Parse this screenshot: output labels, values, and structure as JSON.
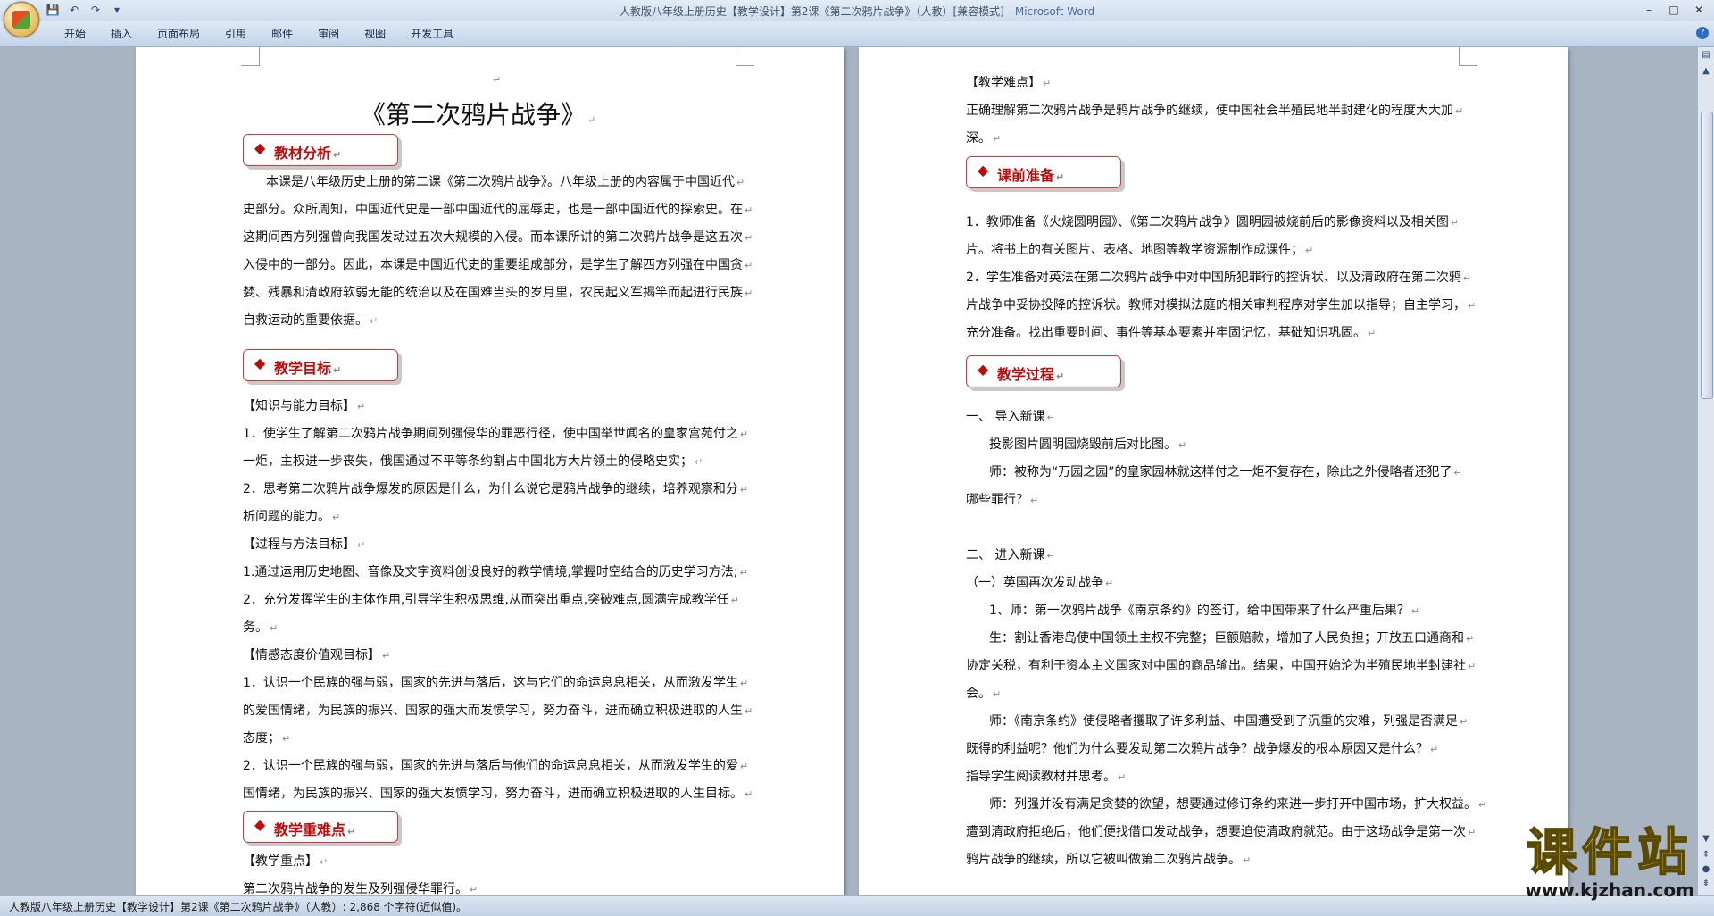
{
  "window": {
    "title": "人教版八年级上册历史【教学设计】第2课《第二次鸦片战争》（人教）[兼容模式] -",
    "app_name": "Microsoft Word",
    "controls": [
      "–",
      "□",
      "✕"
    ]
  },
  "quick_access": [
    "save",
    "undo",
    "redo",
    "customize"
  ],
  "ribbon_tabs": [
    "开始",
    "插入",
    "页面布局",
    "引用",
    "邮件",
    "审阅",
    "视图",
    "开发工具"
  ],
  "left_page": {
    "title": "《第二次鸦片战争》",
    "sections": {
      "analysis": "教材分析",
      "goals": "教学目标",
      "key_points": "教学重难点"
    },
    "lines": [
      "本课是八年级历史上册的第二课《第二次鸦片战争》。八年级上册的内容属于中国近代",
      "史部分。众所周知，中国近代史是一部中国近代的屈辱史，也是一部中国近代的探索史。在",
      "这期间西方列强曾向我国发动过五次大规模的入侵。而本课所讲的第二次鸦片战争是这五次",
      "入侵中的一部分。因此，本课是中国近代史的重要组成部分，是学生了解西方列强在中国贪",
      "婪、残暴和清政府软弱无能的统治以及在国难当头的岁月里，农民起义军揭竿而起进行民族",
      "自救运动的重要依据。",
      "【知识与能力目标】",
      "1．使学生了解第二次鸦片战争期间列强侵华的罪恶行径，使中国举世闻名的皇家宫苑付之",
      "一炬，主权进一步丧失，俄国通过不平等条约割占中国北方大片领土的侵略史实；",
      "2．思考第二次鸦片战争爆发的原因是什么，为什么说它是鸦片战争的继续，培养观察和分",
      "析问题的能力。",
      "【过程与方法目标】",
      "1.通过运用历史地图、音像及文字资料创设良好的教学情境,掌握时空结合的历史学习方法;",
      "2．充分发挥学生的主体作用,引导学生积极思维,从而突出重点,突破难点,圆满完成教学任",
      "务。",
      "【情感态度价值观目标】",
      "1．认识一个民族的强与弱，国家的先进与落后，这与它们的命运息息相关，从而激发学生",
      "的爱国情绪，为民族的振兴、国家的强大而发愤学习，努力奋斗，进而确立积极进取的人生",
      "态度；",
      "2．认识一个民族的强与弱，国家的先进与落后与他们的命运息息相关，从而激发学生的爱",
      "国情绪，为民族的振兴、国家的强大发愤学习，努力奋斗，进而确立积极进取的人生目标。",
      "【教学重点】",
      "第二次鸦片战争的发生及列强侵华罪行。"
    ]
  },
  "right_page": {
    "sections": {
      "prep": "课前准备",
      "process": "教学过程"
    },
    "lines": [
      "【教学难点】",
      "正确理解第二次鸦片战争是鸦片战争的继续，使中国社会半殖民地半封建化的程度大大加",
      "深。",
      "1．教师准备《火烧圆明园》、《第二次鸦片战争》圆明园被烧前后的影像资料以及相关图",
      "片。将书上的有关图片、表格、地图等教学资源制作成课件；",
      "2．学生准备对英法在第二次鸦片战争中对中国所犯罪行的控诉状、以及清政府在第二次鸦",
      "片战争中妥协投降的控诉状。教师对模拟法庭的相关审判程序对学生加以指导；自主学习，",
      "充分准备。找出重要时间、事件等基本要素并牢固记忆，基础知识巩固。",
      "一、      导入新课",
      "投影图片圆明园烧毁前后对比图。",
      "师：被称为“万园之园”的皇家园林就这样付之一炬不复存在，除此之外侵略者还犯了",
      "哪些罪行？",
      "二、      进入新课",
      "（一）英国再次发动战争",
      "1、师：第一次鸦片战争《南京条约》的签订，给中国带来了什么严重后果？",
      "生：割让香港岛使中国领土主权不完整；巨额赔款，增加了人民负担；开放五口通商和",
      "协定关税，有利于资本主义国家对中国的商品输出。结果，中国开始沦为半殖民地半封建社",
      "会。",
      "师：《南京条约》使侵略者攫取了许多利益、中国遭受到了沉重的灾难，列强是否满足",
      "既得的利益呢？他们为什么要发动第二次鸦片战争？战争爆发的根本原因又是什么？",
      "指导学生阅读教材并思考。",
      "师：列强并没有满足贪婪的欲望，想要通过修订条约来进一步打开中国市场，扩大权益。",
      "遭到清政府拒绝后，他们便找借口发动战争，想要迫使清政府就范。由于这场战争是第一次",
      "鸦片战争的继续，所以它被叫做第二次鸦片战争。"
    ]
  },
  "status_bar": "人教版八年级上册历史【教学设计】第2课《第二次鸦片战争》（人教）: 2,868 个字符(近似值)。",
  "watermark": {
    "main": "课件站",
    "url": "www.kjzhan.com"
  },
  "accent_colors": {
    "section_text": "#c20a0a",
    "section_border": "#d23b3b",
    "watermark": "#f6d700"
  }
}
